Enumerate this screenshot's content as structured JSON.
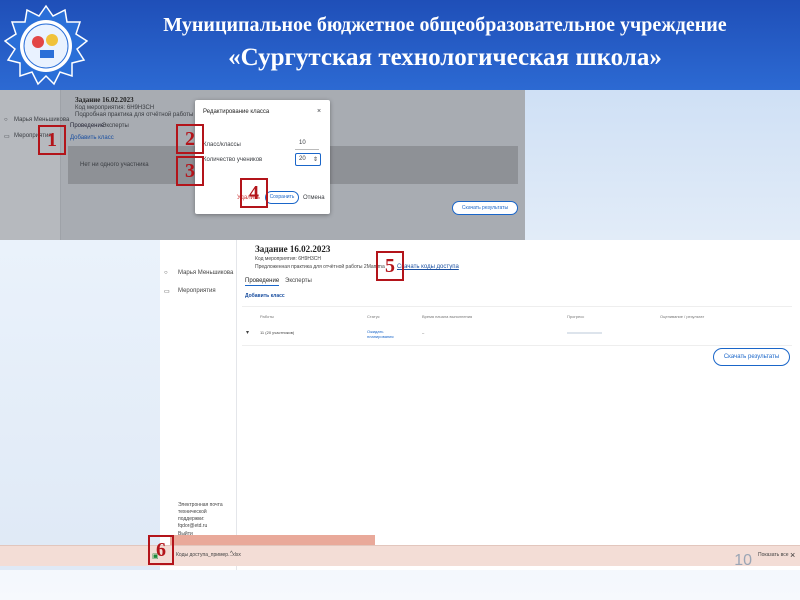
{
  "header": {
    "line1": "Муниципальное бюджетное общеобразовательное учреждение",
    "line2": "«Сургутская технологическая школа»"
  },
  "top_shot": {
    "sidebar": [
      "Марья Меньшикова",
      "Мероприятия"
    ],
    "task_title": "Задание 16.02.2023",
    "task_code": "Код мероприятия: 6H9H3CH",
    "task_desc": "Подробная практика для отчётной работы 2Mamma",
    "tabs": [
      "Проведение",
      "Эксперты"
    ],
    "add_class": "Добавить класс",
    "no_participants": "Нет ни одного участника",
    "download_results": "Скачать результаты",
    "modal": {
      "title": "Редактирование класса",
      "field1_label": "Класс/классы",
      "field1_value": "10",
      "field2_label": "Количество учеников",
      "field2_value": "20",
      "delete_label": "Удалить",
      "save_label": "Сохранить",
      "cancel_label": "Отмена",
      "close": "×"
    }
  },
  "bottom_shot": {
    "sidebar": [
      "Марья Меньшикова",
      "Мероприятия"
    ],
    "sidebar_bottom": [
      "Электронная почта технической поддержки: fqdor@etd.ru",
      "Выйти"
    ],
    "task_title": "Задание 16.02.2023",
    "task_code": "Код мероприятия: 6H9H3CH",
    "task_desc": "Предложенная практика для отчётной работы 2Mamma",
    "download_tasks": "Скачать коды доступа",
    "tabs": [
      "Проведение",
      "Эксперты"
    ],
    "add_class": "Добавить класс",
    "table": {
      "headers": [
        "Работы",
        "Статус",
        "Время начала выполнения",
        "Прогресс",
        "Оценивание / результат"
      ],
      "row": {
        "name": "11 (20 участников)",
        "status": "Ожидать планирования",
        "time": "–"
      }
    },
    "download_results": "Скачать результаты",
    "download_bar": {
      "file": "Коды доступа_пример...xlsx",
      "show_all": "Показать все",
      "close": "×"
    }
  },
  "markers": [
    "1",
    "2",
    "3",
    "4",
    "5",
    "6"
  ],
  "page_number": "10"
}
